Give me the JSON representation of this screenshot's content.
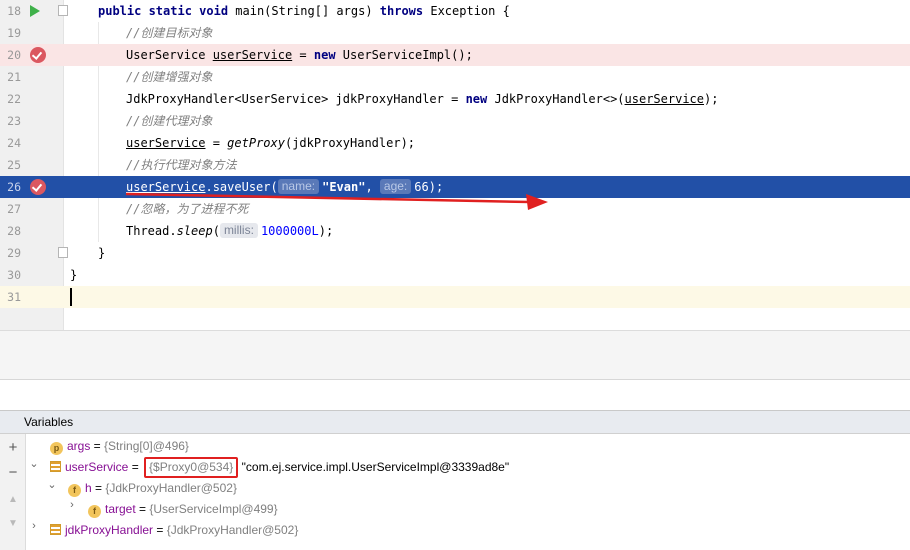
{
  "editor": {
    "lines": [
      {
        "number": "18"
      },
      {
        "number": "19",
        "text": "//创建目标对象"
      },
      {
        "number": "20",
        "t1": "UserService ",
        "var": "userService",
        "t2": " = ",
        "kw": "new",
        "t3": " UserServiceImpl();"
      },
      {
        "number": "21",
        "text": "//创建增强对象"
      },
      {
        "number": "22",
        "t1": "JdkProxyHandler<UserService> jdkProxyHandler = ",
        "kw": "new",
        "t2": " JdkProxyHandler<>(",
        "var": "userService",
        "t3": ");"
      },
      {
        "number": "23",
        "text": "//创建代理对象"
      },
      {
        "number": "24",
        "var": "userService",
        "t1": " = ",
        "fn": "getProxy",
        "t2": "(jdkProxyHandler);"
      },
      {
        "number": "25",
        "text": "//执行代理对象方法"
      },
      {
        "number": "26",
        "var": "userService",
        "t1": ".saveUser(",
        "hint1": "name:",
        "str": "\"Evan\"",
        "t2": ", ",
        "hint2": "age:",
        "num": "66",
        "t3": ");"
      },
      {
        "number": "27",
        "text": "//忽略，为了进程不死"
      },
      {
        "number": "28",
        "t1": "Thread.",
        "fn": "sleep",
        "t2": "(",
        "hint": "millis:",
        "num": "1000000L",
        "t3": ");"
      },
      {
        "number": "29",
        "text": "}"
      },
      {
        "number": "30",
        "text": "}"
      },
      {
        "number": "31"
      }
    ],
    "main_signature": {
      "kw1": "public static void",
      "t1": " main(String[] args) ",
      "kw2": "throws",
      "t2": " Exception {"
    }
  },
  "variables_panel": {
    "title": "Variables",
    "rows": [
      {
        "badge": "p",
        "name": "args",
        "eq": " = ",
        "value": "{String[0]@496}"
      },
      {
        "name": "userService",
        "eq": " = ",
        "value": "{$Proxy0@534}",
        "extra": " \"com.ej.service.impl.UserServiceImpl@3339ad8e\""
      },
      {
        "badge": "f",
        "name": "h",
        "eq": " = ",
        "value": "{JdkProxyHandler@502}"
      },
      {
        "badge": "f",
        "name": "target",
        "eq": " = ",
        "value": "{UserServiceImpl@499}"
      },
      {
        "name": "jdkProxyHandler",
        "eq": " = ",
        "value": "{JdkProxyHandler@502}"
      }
    ]
  },
  "colors": {
    "execution_highlight": "#2250a7",
    "breakpoint": "#db5860",
    "annotation_red": "#e02020"
  }
}
